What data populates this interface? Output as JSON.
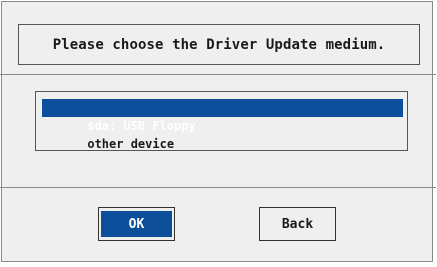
{
  "dialog": {
    "prompt": "Please choose the Driver Update medium.",
    "devices": [
      {
        "label": "sda: USB Floppy",
        "selected": true
      },
      {
        "label": "other device",
        "selected": false
      }
    ],
    "buttons": {
      "ok_label": "OK",
      "back_label": "Back"
    }
  },
  "colors": {
    "selection": "#0d4f9b",
    "background": "#efefef"
  }
}
